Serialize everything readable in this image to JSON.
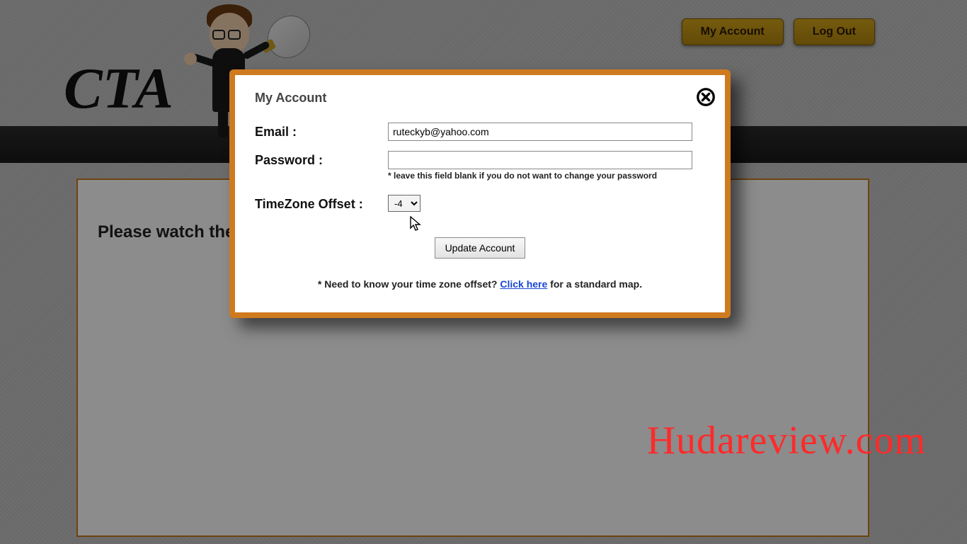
{
  "header": {
    "my_account": "My Account",
    "log_out": "Log Out",
    "logo_text": "CTA"
  },
  "content": {
    "tutorial_line": "Please watch the tuto"
  },
  "modal": {
    "title": "My Account",
    "email_label": "Email :",
    "email_value": "ruteckyb@yahoo.com",
    "password_label": "Password :",
    "password_value": "",
    "password_hint": "* leave this field blank if you do not want to change your password",
    "tz_label": "TimeZone Offset :",
    "tz_value": "-4",
    "update_button": "Update Account",
    "tz_note_prefix": "* Need to know your time zone offset? ",
    "tz_note_link": "Click here",
    "tz_note_suffix": " for a standard map."
  },
  "watermark": "Hudareview.com"
}
